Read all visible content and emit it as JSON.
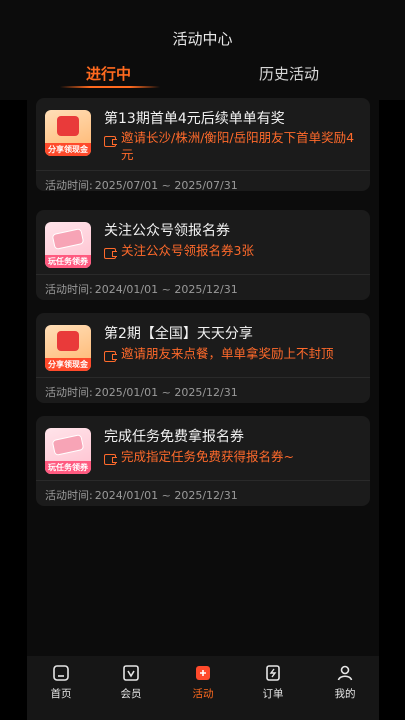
{
  "header": {
    "title": "活动中心",
    "tabs": [
      {
        "label": "进行中",
        "active": true
      },
      {
        "label": "历史活动",
        "active": false
      }
    ]
  },
  "activities": [
    {
      "title": "第13期首单4元后续单单有奖",
      "desc": "邀请长沙/株洲/衡阳/岳阳朋友下首单奖励4元",
      "period_label": "活动时间:",
      "period": "2025/07/01 ~ 2025/07/31",
      "thumb_text": "分享领现金",
      "thumb_style": "red"
    },
    {
      "title": "关注公众号领报名券",
      "desc": "关注公众号领报名券3张",
      "period_label": "活动时间:",
      "period": "2024/01/01 ~ 2025/12/31",
      "thumb_text": "玩任务领券",
      "thumb_style": "pink"
    },
    {
      "title": "第2期【全国】天天分享",
      "desc": "邀请朋友来点餐，单单拿奖励上不封顶",
      "period_label": "活动时间:",
      "period": "2025/01/01 ~ 2025/12/31",
      "thumb_text": "分享领现金",
      "thumb_style": "red"
    },
    {
      "title": "完成任务免费拿报名券",
      "desc": "完成指定任务免费获得报名券~",
      "period_label": "活动时间:",
      "period": "2024/01/01 ~ 2025/12/31",
      "thumb_text": "玩任务领券",
      "thumb_style": "pink"
    }
  ],
  "nav": [
    {
      "label": "首页",
      "icon": "home-icon",
      "active": false
    },
    {
      "label": "会员",
      "icon": "vip-icon",
      "active": false
    },
    {
      "label": "活动",
      "icon": "gift-icon",
      "active": true
    },
    {
      "label": "订单",
      "icon": "order-icon",
      "active": false
    },
    {
      "label": "我的",
      "icon": "profile-icon",
      "active": false
    }
  ],
  "colors": {
    "accent": "#ff6a1f",
    "background": "#000000",
    "card": "#1b1b1b"
  }
}
